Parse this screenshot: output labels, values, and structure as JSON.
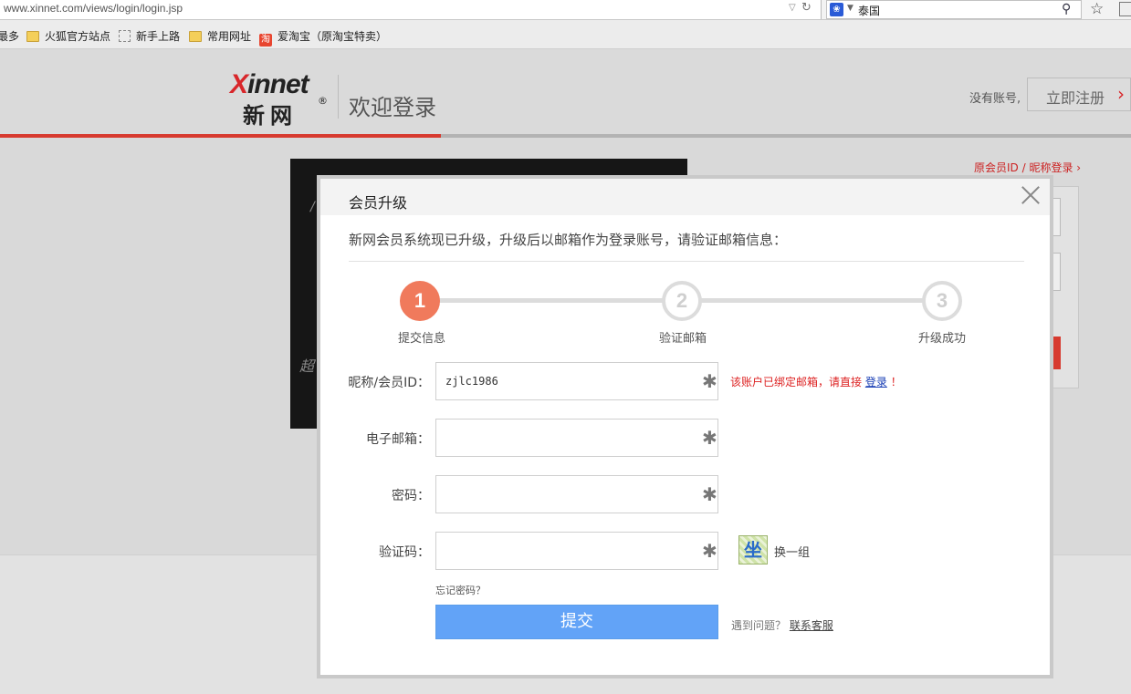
{
  "browser": {
    "url": "www.xinnet.com/views/login/login.jsp",
    "search_text": "泰国",
    "bookmarks": [
      {
        "label": "最多",
        "icon": "none"
      },
      {
        "label": "火狐官方站点",
        "icon": "folder-icon"
      },
      {
        "label": "新手上路",
        "icon": "dashed-page-icon"
      },
      {
        "label": "常用网址",
        "icon": "folder-icon"
      },
      {
        "label": "爱淘宝（原淘宝特卖）",
        "icon": "taobao-icon"
      }
    ]
  },
  "header": {
    "logo_brand": "Xinnet",
    "logo_cn": "新网",
    "logo_reg": "®",
    "title": "欢迎登录",
    "no_account": "没有账号,",
    "register_label": "立即注册",
    "accent_color": "#d73a2f",
    "progress": 0.39
  },
  "background": {
    "banner_text_1": "/",
    "banner_text_2": "超",
    "alt_login_link": "原会员ID / 昵称登录 ›"
  },
  "modal": {
    "title": "会员升级",
    "intro": "新网会员系统现已升级，升级后以邮箱作为登录账号，请验证邮箱信息：",
    "steps": [
      {
        "number": "1",
        "label": "提交信息",
        "active": true
      },
      {
        "number": "2",
        "label": "验证邮箱",
        "active": false
      },
      {
        "number": "3",
        "label": "升级成功",
        "active": false
      }
    ],
    "fields": {
      "nickname": {
        "label": "昵称/会员ID：",
        "value": "zjlc1986"
      },
      "email": {
        "label": "电子邮箱：",
        "value": ""
      },
      "password": {
        "label": "密码：",
        "value": ""
      },
      "captcha": {
        "label": "验证码：",
        "value": ""
      }
    },
    "required_mark": "✱",
    "error_prefix": "该账户已绑定邮箱，请直接",
    "error_link": "登录",
    "error_suffix": "！",
    "captcha_char": "坐",
    "refresh_label": "换一组",
    "forgot_label": "忘记密码？",
    "submit_label": "提交",
    "help_prefix": "遇到问题？",
    "help_link": "联系客服",
    "button_color": "#62a3f7"
  }
}
